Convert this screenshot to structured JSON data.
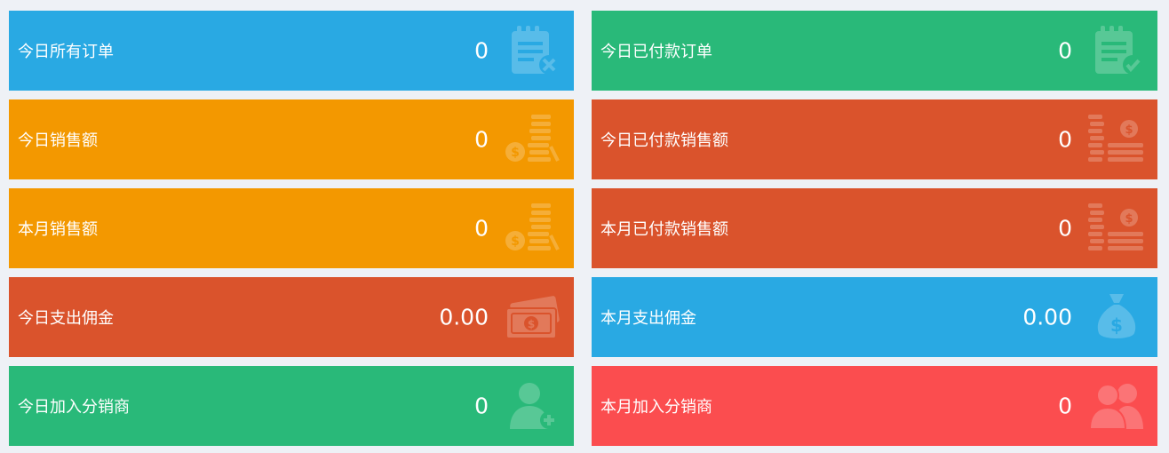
{
  "colors": {
    "background": "#eef1f6",
    "blue": "#29a9e3",
    "green": "#29b979",
    "orange": "#f39800",
    "deep_orange": "#da532c",
    "red": "#fb4d4f"
  },
  "cards": [
    {
      "label": "今日所有订单",
      "value": "0",
      "icon": "order-cancel-icon",
      "color": "#29a9e3"
    },
    {
      "label": "今日已付款订单",
      "value": "0",
      "icon": "order-check-icon",
      "color": "#29b979"
    },
    {
      "label": "今日销售额",
      "value": "0",
      "icon": "coins-icon",
      "color": "#f39800"
    },
    {
      "label": "今日已付款销售额",
      "value": "0",
      "icon": "money-stack-icon",
      "color": "#da532c"
    },
    {
      "label": "本月销售额",
      "value": "0",
      "icon": "coins-icon",
      "color": "#f39800"
    },
    {
      "label": "本月已付款销售额",
      "value": "0",
      "icon": "money-stack-icon",
      "color": "#da532c"
    },
    {
      "label": "今日支出佣金",
      "value": "0.00",
      "icon": "banknote-icon",
      "color": "#da532c"
    },
    {
      "label": "本月支出佣金",
      "value": "0.00",
      "icon": "money-bag-icon",
      "color": "#29a9e3"
    },
    {
      "label": "今日加入分销商",
      "value": "0",
      "icon": "user-add-icon",
      "color": "#29b979"
    },
    {
      "label": "本月加入分销商",
      "value": "0",
      "icon": "users-icon",
      "color": "#fb4d4f"
    }
  ]
}
